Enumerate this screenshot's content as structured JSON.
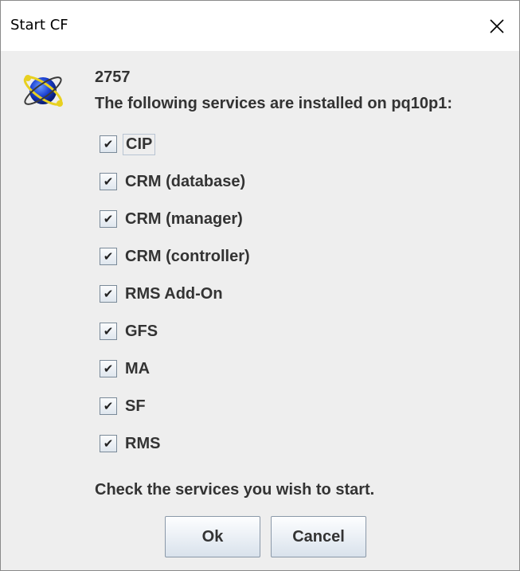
{
  "window": {
    "title": "Start CF"
  },
  "header": {
    "id_text": "2757",
    "message": "The following services are installed on pq10p1:"
  },
  "services": [
    {
      "label": "CIP",
      "checked": true
    },
    {
      "label": "CRM (database)",
      "checked": true
    },
    {
      "label": "CRM (manager)",
      "checked": true
    },
    {
      "label": "CRM (controller)",
      "checked": true
    },
    {
      "label": "RMS Add-On",
      "checked": true
    },
    {
      "label": "GFS",
      "checked": true
    },
    {
      "label": "MA",
      "checked": true
    },
    {
      "label": "SF",
      "checked": true
    },
    {
      "label": "RMS",
      "checked": true
    }
  ],
  "instruction": "Check the services you wish to start.",
  "buttons": {
    "ok": "Ok",
    "cancel": "Cancel"
  },
  "icons": {
    "app": "atom-globe-icon",
    "close": "close-icon",
    "check": "checkmark-icon"
  }
}
